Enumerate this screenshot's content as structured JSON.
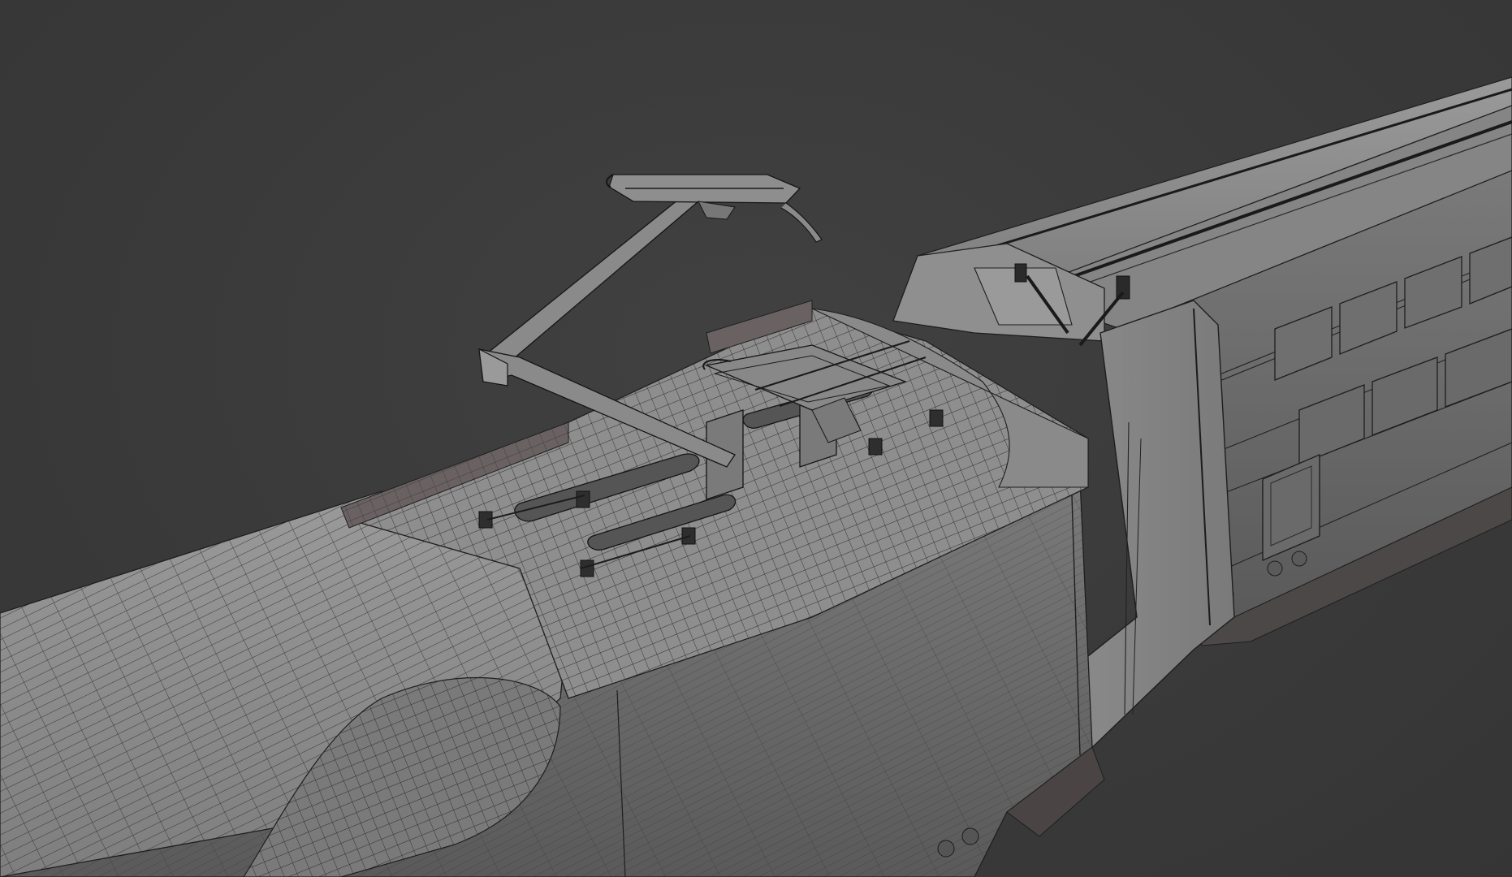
{
  "scene": {
    "background_color": "#3a3a3a",
    "subject": "train-wireframe",
    "colors": {
      "body_light": "#8c8c8c",
      "body_mid": "#7a7a7a",
      "body_dark": "#5e5e5e",
      "wire": "#1c1c1c",
      "shadow": "#4a4444"
    }
  }
}
